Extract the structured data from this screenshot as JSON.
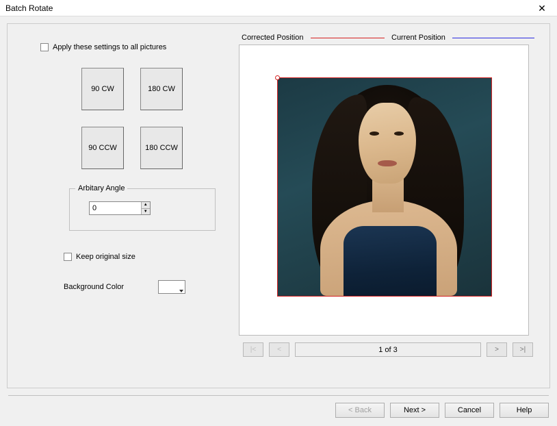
{
  "window": {
    "title": "Batch Rotate"
  },
  "apply_all": {
    "label": "Apply these settings to all pictures",
    "checked": false
  },
  "rotate_buttons": {
    "cw90": "90 CW",
    "cw180": "180 CW",
    "ccw90": "90 CCW",
    "ccw180": "180 CCW"
  },
  "arbitrary": {
    "group_label": "Arbitary Angle",
    "value": "0"
  },
  "keep_size": {
    "label": "Keep original size",
    "checked": false
  },
  "bgcolor": {
    "label": "Background Color",
    "value": "#ffffff"
  },
  "legend": {
    "corrected": {
      "label": "Corrected Position",
      "color": "#d42020"
    },
    "current": {
      "label": "Current Position",
      "color": "#2a2adf"
    }
  },
  "pager": {
    "first": "|<",
    "prev": "<",
    "status": "1 of 3",
    "next": ">",
    "last": ">|"
  },
  "footer": {
    "back": "< Back",
    "next": "Next >",
    "cancel": "Cancel",
    "help": "Help"
  }
}
